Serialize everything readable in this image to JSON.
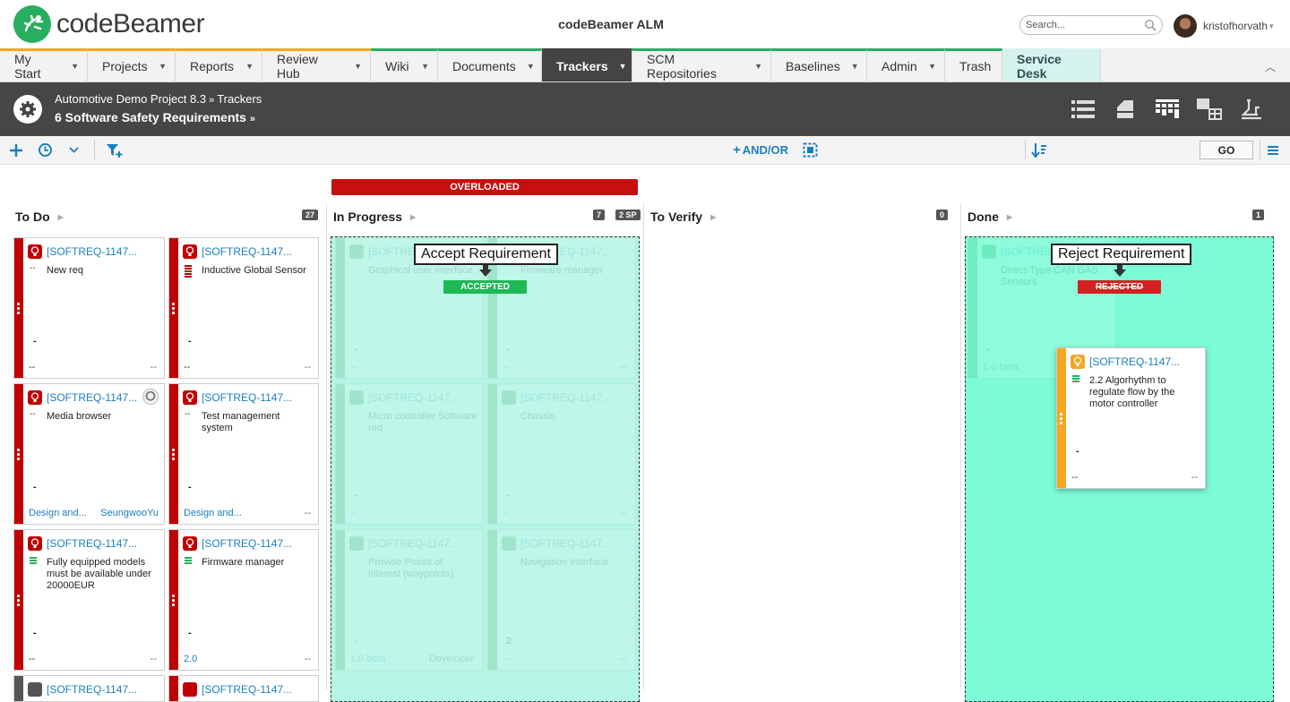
{
  "app": {
    "logo_text": "codeBeamer",
    "title": "codeBeamer ALM",
    "search_placeholder": "Search...",
    "username": "kristofhorvath",
    "user_menu_caret": "▾"
  },
  "nav": {
    "tabs": [
      {
        "label": "My Start",
        "arrow": "▼"
      },
      {
        "label": "Projects",
        "arrow": "▼"
      },
      {
        "label": "Reports",
        "arrow": "▼"
      },
      {
        "label": "Review Hub",
        "arrow": "▼"
      },
      {
        "label": "Wiki",
        "arrow": "▼"
      },
      {
        "label": "Documents",
        "arrow": "▼"
      },
      {
        "label": "Trackers",
        "arrow": "▼"
      },
      {
        "label": "SCM Repositories",
        "arrow": "▼"
      },
      {
        "label": "Baselines",
        "arrow": "▼"
      },
      {
        "label": "Admin",
        "arrow": "▼"
      },
      {
        "label": "Trash",
        "arrow": ""
      },
      {
        "label": "Service Desk",
        "arrow": ""
      }
    ],
    "active": "Trackers",
    "collapse_glyph": "︿"
  },
  "header": {
    "project": "Automotive Demo Project 8.3",
    "section": "Trackers",
    "tracker": "6 Software Safety Requirements",
    "crumb_sep": "»"
  },
  "toolbar": {
    "andor_label": "AND/OR",
    "go_label": "GO"
  },
  "board": {
    "overloaded_label": "OVERLOADED",
    "columns": [
      {
        "name": "To Do",
        "count": "27"
      },
      {
        "name": "In Progress",
        "count": "7",
        "sp": "2 SP"
      },
      {
        "name": "To Verify",
        "count": "0"
      },
      {
        "name": "Done",
        "count": "1"
      }
    ],
    "accept_label": "Accept Requirement",
    "accepted_badge": "ACCEPTED",
    "reject_label": "Reject Requirement",
    "rejected_badge": "REJECTED"
  },
  "cards": [
    {
      "id": "[SOFTREQ-1147...",
      "title": "New req",
      "priority": "--",
      "mid": "-",
      "bl": "--",
      "br": "--"
    },
    {
      "id": "[SOFTREQ-1147...",
      "title": "Inductive Global Sensor",
      "priority": "≡",
      "mid": "-",
      "bl": "--",
      "br": "--"
    },
    {
      "id": "[SOFTREQ-1147...",
      "title": "Media browser",
      "priority": "--",
      "mid": "-",
      "bl": "Design and...",
      "br": "SeungwooYu"
    },
    {
      "id": "[SOFTREQ-1147...",
      "title": "Test management system",
      "priority": "--",
      "mid": "-",
      "bl": "Design and...",
      "br": "--"
    },
    {
      "id": "[SOFTREQ-1147...",
      "title": "Fully equipped models must be available under 20000EUR",
      "priority": "≡",
      "mid": "-",
      "bl": "--",
      "br": "--"
    },
    {
      "id": "[SOFTREQ-1147...",
      "title": "Firmware manager",
      "priority": "≡",
      "mid": "-",
      "bl": "2.0",
      "br": "--"
    },
    {
      "id": "[SOFTREQ-1147...",
      "title": "",
      "priority": "",
      "mid": "",
      "bl": "",
      "br": ""
    },
    {
      "id": "[SOFTREQ-1147...",
      "title": "",
      "priority": "",
      "mid": "",
      "bl": "",
      "br": ""
    }
  ],
  "progress_cards": [
    {
      "id": "[SOFTREQ-1147...",
      "title": "Graphical user interface",
      "mid": "-",
      "bl": "--",
      "br": ""
    },
    {
      "id": "[SOFTREQ-1147...",
      "title": "Firmware manager",
      "mid": "-",
      "bl": "--",
      "br": "--"
    },
    {
      "id": "[SOFTREQ-1147...",
      "title": "Micro controller Software req",
      "mid": "-",
      "bl": "--",
      "br": ""
    },
    {
      "id": "[SOFTREQ-1147...",
      "title": "Chassis",
      "mid": "-",
      "bl": "--",
      "br": "--"
    },
    {
      "id": "[SOFTREQ-1147...",
      "title": "Provide Points of interest (waypoints)",
      "mid": "-",
      "bl": "1.0 beta",
      "br": "Developer"
    },
    {
      "id": "[SOFTREQ-1147...",
      "title": "Navigation Interface",
      "mid": "2",
      "bl": "--",
      "br": "--"
    }
  ],
  "done_ghost": {
    "id": "[SOFTREQ-1147...",
    "title": "Direct-Type CAN GAS Sensors",
    "mid": "-",
    "bl": "1.0 beta"
  },
  "drag_card": {
    "id": "[SOFTREQ-1147...",
    "title": "2.2 Algorhythm to regulate flow by the motor controller",
    "priority": "≡",
    "mid": "-",
    "bl": "--",
    "br": "--"
  },
  "colors": {
    "brand_green": "#27ae60",
    "card_red": "#c00000",
    "card_orange": "#f5a623",
    "accept_zone": "#b4f5e4",
    "done_zone": "#7cfcd6",
    "overloaded_red": "#c80f0f",
    "accepted_green": "#1db954",
    "rejected_red": "#d42020",
    "link_blue": "#1a7fc0"
  }
}
